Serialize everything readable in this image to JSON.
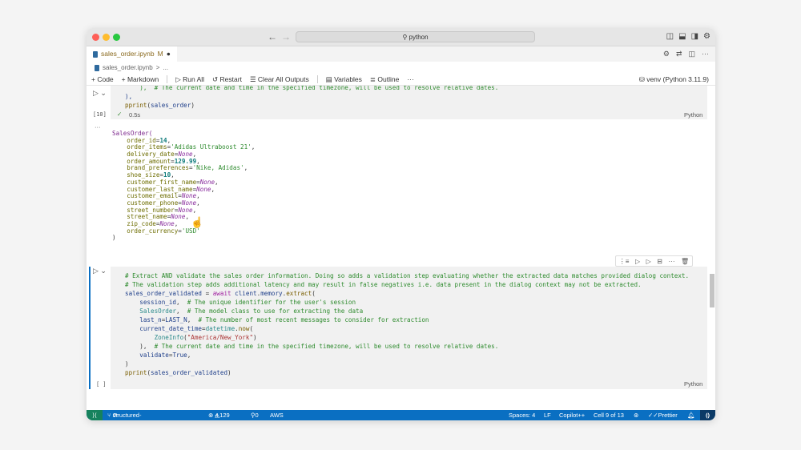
{
  "window": {
    "search": "python",
    "nav_back": "←",
    "nav_forward": "→"
  },
  "tab": {
    "label": "sales_order.ipynb",
    "modified": "M",
    "dirty": "●"
  },
  "breadcrumb": {
    "file": "sales_order.ipynb",
    "sep": ">",
    "more": "..."
  },
  "toolbar": {
    "code": "+ Code",
    "markdown": "+ Markdown",
    "run_all": "Run All",
    "restart": "Restart",
    "clear": "Clear All Outputs",
    "variables": "Variables",
    "outline": "Outline",
    "more": "···",
    "kernel": "venv (Python 3.11.9)"
  },
  "cell1": {
    "exec_count": "[10]",
    "status": "0.5s",
    "lang": "Python",
    "lines": [
      [
        [
          "    ),  # The current date and time in the specified timezone, will be used to resolve relative dates.",
          "c-cm"
        ]
      ],
      [
        [
          "),",
          "c-var"
        ]
      ],
      [
        [
          "pprint",
          "c-fn"
        ],
        [
          "(",
          "c-p"
        ],
        [
          "sales_order",
          "c-var"
        ],
        [
          ")",
          "c-p"
        ]
      ]
    ]
  },
  "output": {
    "lines": [
      [
        [
          "SalesOrder(",
          "c-sc"
        ]
      ],
      [
        [
          "    order_id",
          "c-key"
        ],
        [
          "=",
          "c-p"
        ],
        [
          "14",
          "c-num"
        ],
        [
          ",",
          "c-p"
        ]
      ],
      [
        [
          "    order_items",
          "c-key"
        ],
        [
          "=",
          "c-p"
        ],
        [
          "'Adidas Ultraboost 21'",
          "c-ostr"
        ],
        [
          ",",
          "c-p"
        ]
      ],
      [
        [
          "    delivery_date",
          "c-key"
        ],
        [
          "=",
          "c-p"
        ],
        [
          "None",
          "c-none"
        ],
        [
          ",",
          "c-p"
        ]
      ],
      [
        [
          "    order_amount",
          "c-key"
        ],
        [
          "=",
          "c-p"
        ],
        [
          "129.99",
          "c-num"
        ],
        [
          ",",
          "c-p"
        ]
      ],
      [
        [
          "    brand_preferences",
          "c-key"
        ],
        [
          "=",
          "c-p"
        ],
        [
          "'Nike, Adidas'",
          "c-ostr"
        ],
        [
          ",",
          "c-p"
        ]
      ],
      [
        [
          "    shoe_size",
          "c-key"
        ],
        [
          "=",
          "c-p"
        ],
        [
          "10",
          "c-num"
        ],
        [
          ",",
          "c-p"
        ]
      ],
      [
        [
          "    customer_first_name",
          "c-key"
        ],
        [
          "=",
          "c-p"
        ],
        [
          "None",
          "c-none"
        ],
        [
          ",",
          "c-p"
        ]
      ],
      [
        [
          "    customer_last_name",
          "c-key"
        ],
        [
          "=",
          "c-p"
        ],
        [
          "None",
          "c-none"
        ],
        [
          ",",
          "c-p"
        ]
      ],
      [
        [
          "    customer_email",
          "c-key"
        ],
        [
          "=",
          "c-p"
        ],
        [
          "None",
          "c-none"
        ],
        [
          ",",
          "c-p"
        ]
      ],
      [
        [
          "    customer_phone",
          "c-key"
        ],
        [
          "=",
          "c-p"
        ],
        [
          "None",
          "c-none"
        ],
        [
          ",",
          "c-p"
        ]
      ],
      [
        [
          "    street_number",
          "c-key"
        ],
        [
          "=",
          "c-p"
        ],
        [
          "None",
          "c-none"
        ],
        [
          ",",
          "c-p"
        ]
      ],
      [
        [
          "    street_name",
          "c-key"
        ],
        [
          "=",
          "c-p"
        ],
        [
          "None",
          "c-none"
        ],
        [
          ",",
          "c-p"
        ]
      ],
      [
        [
          "    zip_code",
          "c-key"
        ],
        [
          "=",
          "c-p"
        ],
        [
          "None",
          "c-none"
        ],
        [
          ",",
          "c-p"
        ]
      ],
      [
        [
          "    order_currency",
          "c-key"
        ],
        [
          "=",
          "c-p"
        ],
        [
          "'USD'",
          "c-ostr"
        ]
      ],
      [
        [
          ")",
          "c-p"
        ]
      ]
    ]
  },
  "cell2": {
    "exec_count": "[ ]",
    "lang": "Python",
    "lines": [
      [
        [
          "# Extract AND validate the sales order information. Doing so adds a validation step evaluating whether the extracted data matches provided dialog context.",
          "c-cm"
        ]
      ],
      [
        [
          "# The validation step adds additional latency and may result in false negatives i.e. data present in the dialog context may not be extracted.",
          "c-cm"
        ]
      ],
      [
        [
          "sales_order_validated",
          "c-var"
        ],
        [
          " = ",
          "c-p"
        ],
        [
          "await",
          "c-kw"
        ],
        [
          " client",
          "c-var"
        ],
        [
          ".",
          "c-p"
        ],
        [
          "memory",
          "c-var"
        ],
        [
          ".",
          "c-p"
        ],
        [
          "extract",
          "c-fn"
        ],
        [
          "(",
          "c-p"
        ]
      ],
      [
        [
          "    session_id",
          "c-var"
        ],
        [
          ",  ",
          "c-p"
        ],
        [
          "# The unique identifier for the user's session",
          "c-cm"
        ]
      ],
      [
        [
          "    SalesOrder",
          "c-cls"
        ],
        [
          ",  ",
          "c-p"
        ],
        [
          "# The model class to use for extracting the data",
          "c-cm"
        ]
      ],
      [
        [
          "    last_n",
          "c-var"
        ],
        [
          "=",
          "c-p"
        ],
        [
          "LAST_N",
          "c-var"
        ],
        [
          ",  ",
          "c-p"
        ],
        [
          "# The number of most recent messages to consider for extraction",
          "c-cm"
        ]
      ],
      [
        [
          "    current_date_time",
          "c-var"
        ],
        [
          "=",
          "c-p"
        ],
        [
          "datetime",
          "c-cls"
        ],
        [
          ".",
          "c-p"
        ],
        [
          "now",
          "c-fn"
        ],
        [
          "(",
          "c-p"
        ]
      ],
      [
        [
          "        ZoneInfo",
          "c-cls"
        ],
        [
          "(",
          "c-p"
        ],
        [
          "\"America/New_York\"",
          "c-str"
        ],
        [
          ")",
          "c-p"
        ]
      ],
      [
        [
          "    ),  ",
          "c-p"
        ],
        [
          "# The current date and time in the specified timezone, will be used to resolve relative dates.",
          "c-cm"
        ]
      ],
      [
        [
          "    validate",
          "c-var"
        ],
        [
          "=",
          "c-p"
        ],
        [
          "True",
          "c-var"
        ],
        [
          ",",
          "c-p"
        ]
      ],
      [
        [
          ")",
          "c-p"
        ]
      ],
      [
        [
          "pprint",
          "c-fn"
        ],
        [
          "(",
          "c-p"
        ],
        [
          "sales_order_validated",
          "c-var"
        ],
        [
          ")",
          "c-p"
        ]
      ]
    ]
  },
  "statusbar": {
    "branch": "structured-data-extraction*",
    "errors": "4",
    "warnings": "129",
    "ports": "0",
    "aws": "AWS",
    "spaces": "Spaces: 4",
    "eol": "LF",
    "copilot": "Copilot++",
    "cell": "Cell 9 of 13",
    "prettier": "Prettier"
  },
  "colors": {
    "accent": "#0a6fc2",
    "remote": "#16825d"
  }
}
